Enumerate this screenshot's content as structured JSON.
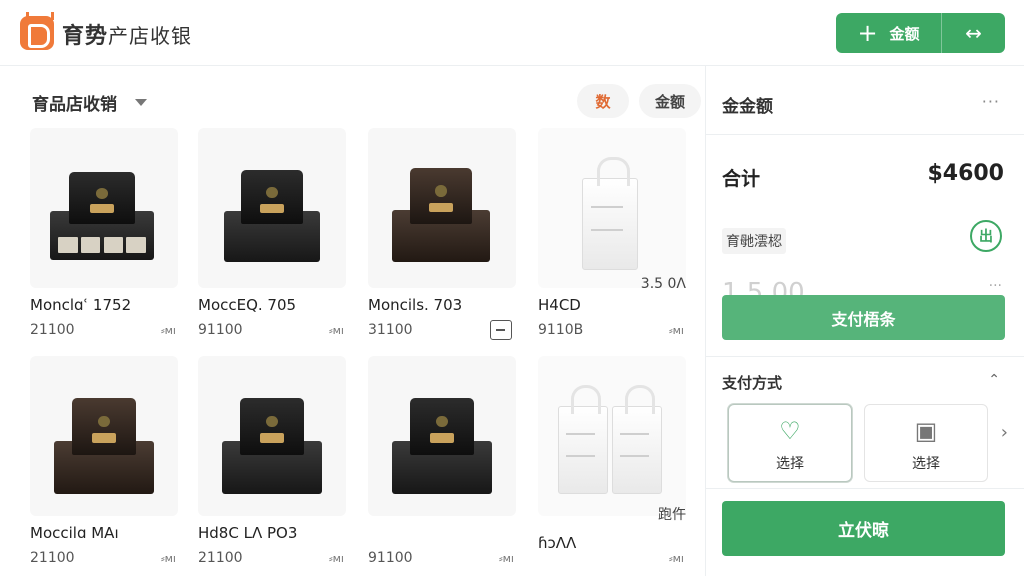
{
  "app": {
    "title": "育势",
    "subtitle": "产店收银",
    "add_label": "金额",
    "add_icon": "plus-icon",
    "swap_icon": "swap-arrows-icon",
    "brand_color": "#f07a3a",
    "accent_color": "#3da864"
  },
  "catalog": {
    "category": "育品店收销",
    "pill_count": "数",
    "pill_amount": "金额"
  },
  "products": [
    {
      "name": "Monclɑʿ 1752",
      "price": "21100",
      "tag": "⸗мı",
      "extra": ""
    },
    {
      "name": "MoccEQ. 705",
      "price": "91100",
      "tag": "⸗мı",
      "extra": ""
    },
    {
      "name": "Moncils. 703",
      "price": "31100",
      "tag": "",
      "extra": ""
    },
    {
      "name": "H4CD",
      "price": "9110B",
      "tag": "⸗мı",
      "extra": "3.5 0Ʌ"
    },
    {
      "name": "Moccilɑ MAı",
      "price": "21100",
      "tag": "⸗мı",
      "extra": ""
    },
    {
      "name": "Hd8C LɅ PO3",
      "price": "21100",
      "tag": "⸗мı",
      "extra": ""
    },
    {
      "name": "",
      "price": "91100",
      "tag": "⸗мı",
      "extra": ""
    },
    {
      "name": "ɦɔɅɅ",
      "price": "",
      "tag": "⸗мı",
      "extra": "跑仵"
    }
  ],
  "cart": {
    "title": "金金额",
    "more": "···",
    "total_label": "合计",
    "total_value": "$4600",
    "discount_label": "育毑澐梕",
    "discount_icon": "出",
    "ghost_amount": "1.5 00",
    "ghost_more": "···",
    "pay_record_label": "支付梧条",
    "payment_method_title": "支付方式",
    "collapse_icon": "chevron-up-icon",
    "method_1_label": "选择",
    "method_2_label": "选择",
    "next_icon": "chevron-right-icon",
    "confirm_label": "立伏晾"
  }
}
